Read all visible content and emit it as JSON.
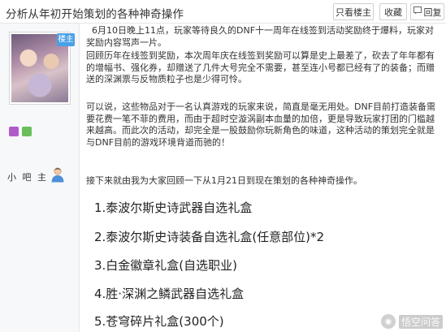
{
  "header": {
    "title": "分析从年初开始策划的各种神奇操作",
    "buttons": [
      {
        "label": "只看楼主",
        "icon": ""
      },
      {
        "label": "收藏",
        "icon": ""
      },
      {
        "label": "回复",
        "icon": "reply-icon"
      }
    ]
  },
  "user": {
    "badge": "楼主",
    "name": "小 吧 主"
  },
  "post": {
    "paragraphs": [
      "6月10日晚上11点，玩家等待良久的DNF十一周年在线签到活动奖励终于爆料，玩家对奖励内容骂声一片。",
      "回顾历年在线签到奖励，本次周年庆在线签到奖励可以算是史上最差了，砍去了年年都有的增幅书、强化券，却赠送了几件大号完全不需要，甚至连小号都已经有了的装备；而赠送的深渊票与反物质粒子也是少得可怜。",
      "可以说，这些物品对于一名认真游戏的玩家来说，简直是毫无用处。DNF目前打造装备需要花费一笔不菲的费用，而由于超时空漩涡副本血量的加倍，更是导致玩家打团的门槛越来越高。而此次的活动，却完全是一股鼓励你玩新角色的味道，这种活动的策划完全就是与DNF目前的游戏环境背道而驰的！",
      "接下来就由我为大家回顾一下从1月21日到现在策划的各种神奇操作。"
    ],
    "list": [
      "1.泰波尔斯史诗武器自选礼盒",
      "2.泰波尔斯史诗装备自选礼盒(任意部位)*2",
      "3.白金徽章礼盒(自选职业)",
      "4.胜·深渊之鳞武器自选礼盒",
      "5.苍穹碎片礼盒(300个)"
    ]
  },
  "watermark": {
    "text": "悟空问答"
  }
}
